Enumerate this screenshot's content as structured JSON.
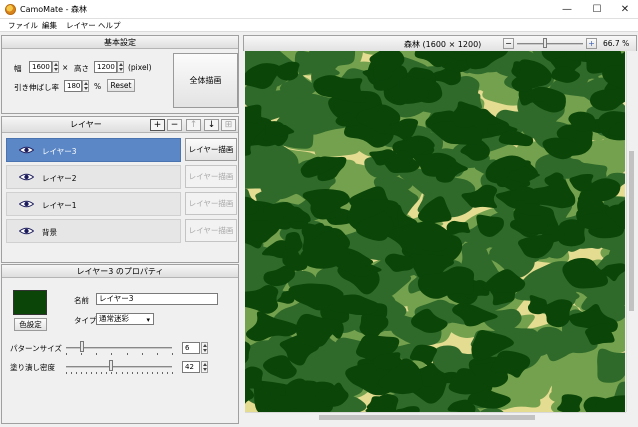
{
  "window": {
    "title": "CamoMate - 森林",
    "minimize_glyph": "—",
    "maximize_glyph": "☐",
    "close_glyph": "✕"
  },
  "menu": [
    "ファイル",
    "編集",
    "レイヤー",
    "ヘルプ"
  ],
  "basic_settings": {
    "header": "基本設定",
    "width_label": "幅",
    "width_value": "1600",
    "times": "×",
    "height_label": "高さ",
    "height_value": "1200",
    "unit": "(pixel)",
    "stretch_label": "引き伸ばし率",
    "stretch_value": "180",
    "percent": "%",
    "reset_label": "Reset",
    "draw_all_label": "全体描画"
  },
  "layers": {
    "header": "レイヤー",
    "tool_add": "+",
    "tool_remove": "−",
    "tool_up": "↑",
    "tool_down": "↓",
    "tool_options": "⊞",
    "items": [
      {
        "name": "レイヤー3",
        "button": "レイヤー描画"
      },
      {
        "name": "レイヤー2",
        "button": "レイヤー描画"
      },
      {
        "name": "レイヤー1",
        "button": "レイヤー描画"
      },
      {
        "name": "背景",
        "button": "レイヤー描画"
      }
    ],
    "selected_index": 0
  },
  "properties": {
    "header": "レイヤー3 のプロパティ",
    "color_button": "色設定",
    "swatch_color": "#0b4508",
    "name_label": "名前",
    "name_value": "レイヤー3",
    "type_label": "タイプ",
    "type_value": "通常迷彩",
    "pattern_size_label": "パターンサイズ",
    "pattern_size_value": "6",
    "pattern_size_fraction": 0.15,
    "fill_density_label": "塗り潰し密度",
    "fill_density_value": "42",
    "fill_density_fraction": 0.42
  },
  "preview": {
    "title": "森林 (1600 × 1200)",
    "zoom_out": "−",
    "zoom_in": "+",
    "zoom_label": "66.7 %",
    "zoom_fraction": 0.42,
    "colors": {
      "background": "#e4dc90",
      "layer1": "#74a14e",
      "layer2": "#2f6a2a",
      "layer3": "#0b4508"
    }
  }
}
